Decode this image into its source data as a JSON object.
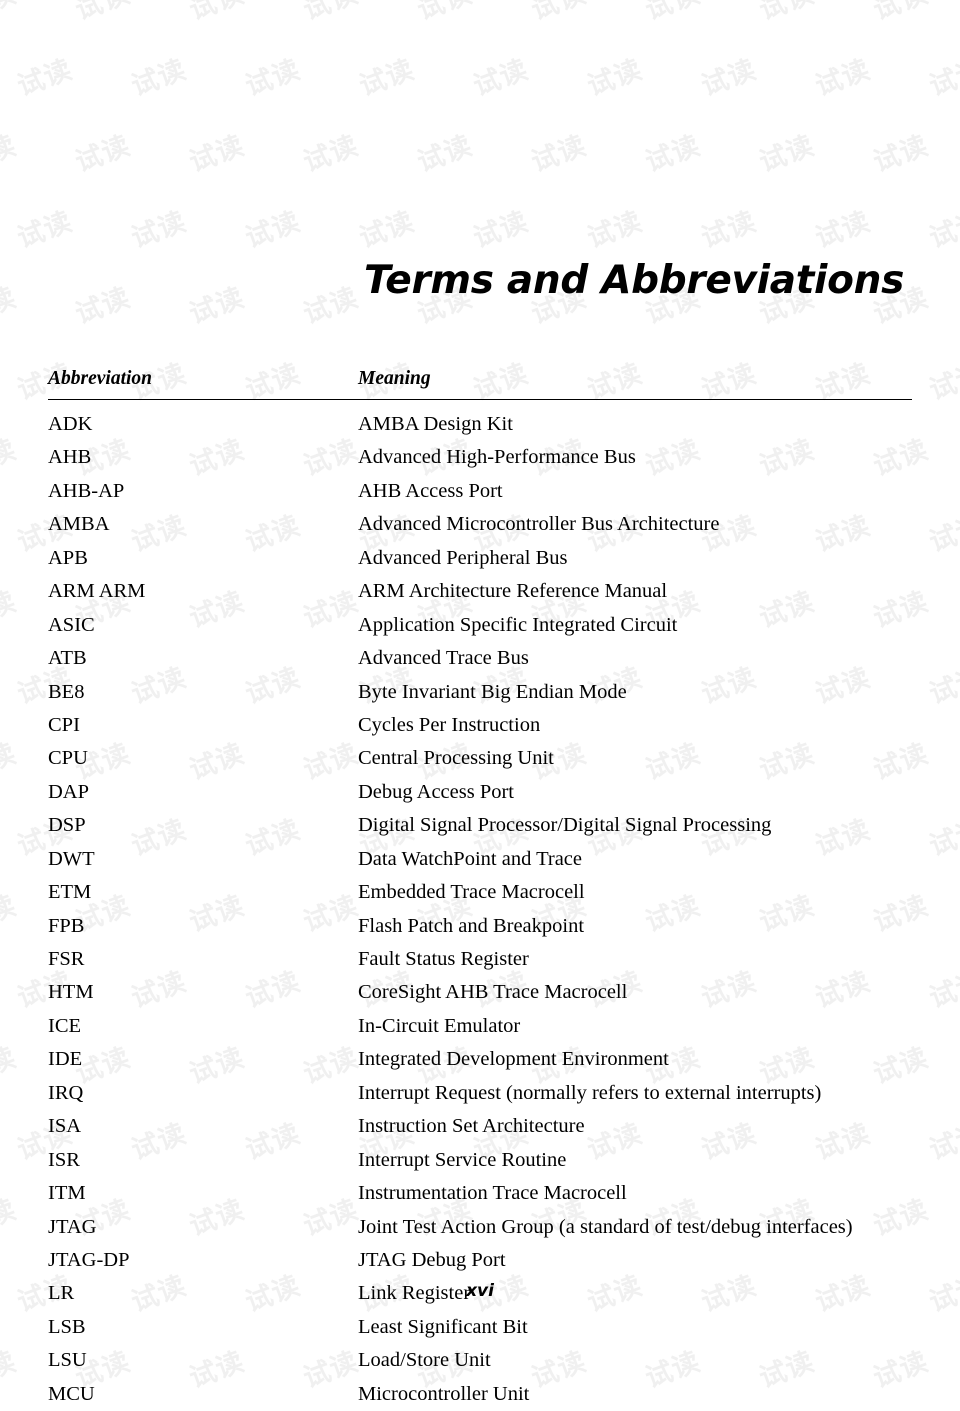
{
  "document": {
    "title": "Terms and Abbreviations",
    "page_number": "xvi",
    "watermark_text": "试读"
  },
  "table": {
    "headers": {
      "abbreviation": "Abbreviation",
      "meaning": "Meaning"
    },
    "rows": [
      {
        "abbr": "ADK",
        "meaning": "AMBA Design Kit"
      },
      {
        "abbr": "AHB",
        "meaning": "Advanced High-Performance Bus"
      },
      {
        "abbr": "AHB-AP",
        "meaning": "AHB Access Port"
      },
      {
        "abbr": "AMBA",
        "meaning": "Advanced Microcontroller Bus Architecture"
      },
      {
        "abbr": "APB",
        "meaning": "Advanced Peripheral Bus"
      },
      {
        "abbr": "ARM ARM",
        "meaning": "ARM Architecture Reference Manual"
      },
      {
        "abbr": "ASIC",
        "meaning": "Application Specific Integrated Circuit"
      },
      {
        "abbr": "ATB",
        "meaning": "Advanced Trace Bus"
      },
      {
        "abbr": "BE8",
        "meaning": "Byte Invariant Big Endian Mode"
      },
      {
        "abbr": "CPI",
        "meaning": "Cycles Per Instruction"
      },
      {
        "abbr": "CPU",
        "meaning": "Central Processing Unit"
      },
      {
        "abbr": "DAP",
        "meaning": "Debug Access Port"
      },
      {
        "abbr": "DSP",
        "meaning": "Digital Signal Processor/Digital Signal Processing"
      },
      {
        "abbr": "DWT",
        "meaning": "Data WatchPoint and Trace"
      },
      {
        "abbr": "ETM",
        "meaning": "Embedded Trace Macrocell"
      },
      {
        "abbr": "FPB",
        "meaning": "Flash Patch and Breakpoint"
      },
      {
        "abbr": "FSR",
        "meaning": "Fault Status Register"
      },
      {
        "abbr": "HTM",
        "meaning": "CoreSight AHB Trace Macrocell"
      },
      {
        "abbr": "ICE",
        "meaning": "In-Circuit Emulator"
      },
      {
        "abbr": "IDE",
        "meaning": "Integrated Development Environment"
      },
      {
        "abbr": "IRQ",
        "meaning": "Interrupt Request (normally refers to external interrupts)"
      },
      {
        "abbr": "ISA",
        "meaning": "Instruction Set Architecture"
      },
      {
        "abbr": "ISR",
        "meaning": "Interrupt Service Routine"
      },
      {
        "abbr": "ITM",
        "meaning": "Instrumentation Trace Macrocell"
      },
      {
        "abbr": "JTAG",
        "meaning": "Joint Test Action Group (a standard of test/debug interfaces)"
      },
      {
        "abbr": "JTAG-DP",
        "meaning": "JTAG Debug Port"
      },
      {
        "abbr": "LR",
        "meaning": "Link Register"
      },
      {
        "abbr": "LSB",
        "meaning": "Least Significant Bit"
      },
      {
        "abbr": "LSU",
        "meaning": "Load/Store Unit"
      },
      {
        "abbr": "MCU",
        "meaning": "Microcontroller Unit"
      }
    ]
  }
}
